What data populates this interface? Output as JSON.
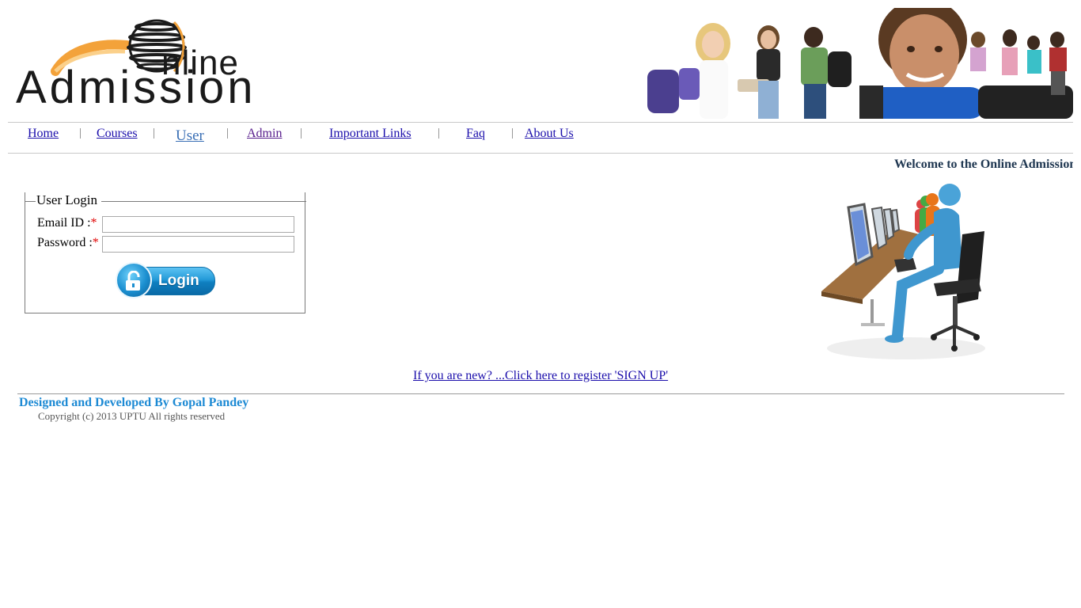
{
  "logo": {
    "line1": "nline",
    "line2": "Admission"
  },
  "nav": {
    "items": [
      {
        "label": "Home"
      },
      {
        "label": "Courses"
      },
      {
        "label": "User"
      },
      {
        "label": "Admin"
      },
      {
        "label": "Important Links"
      },
      {
        "label": "Faq"
      },
      {
        "label": "About Us"
      }
    ],
    "separator": "|"
  },
  "welcome": "Welcome to the Online Admission",
  "login": {
    "legend": "User Login",
    "email_label": "Email ID :",
    "password_label": "Password :",
    "required_mark": "*",
    "email_value": "",
    "password_value": "",
    "button_label": "Login"
  },
  "signup_link": "If you are new? ...Click here to register 'SIGN UP'",
  "footer": {
    "designed_by": "Designed and Developed By Gopal Pandey",
    "copyright": "Copyright (c) 2013 UPTU All rights reserved"
  },
  "colors": {
    "link": "#1a0dab",
    "visited": "#551a8b",
    "accent": "#1d8ad4",
    "required": "#e00000"
  },
  "icons": [
    "globe-logo-icon",
    "students-banner-image",
    "unlock-icon",
    "computer-lab-illustration"
  ]
}
